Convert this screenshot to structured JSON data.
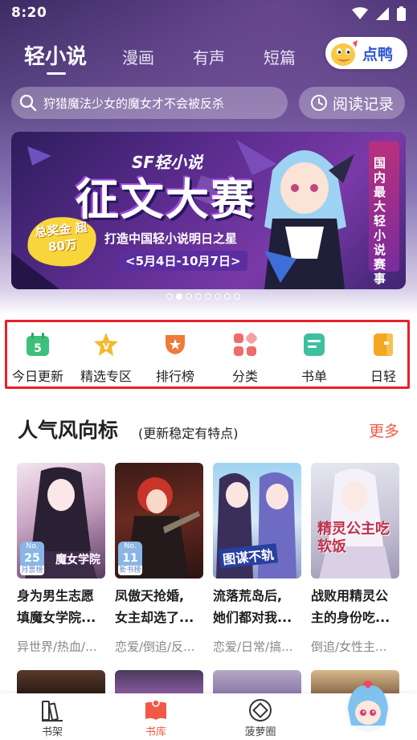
{
  "status_bar": {
    "time": "8:20"
  },
  "top_tabs": [
    {
      "label": "轻小说",
      "active": true
    },
    {
      "label": "漫画",
      "active": false
    },
    {
      "label": "有声",
      "active": false
    },
    {
      "label": "短篇",
      "active": false
    }
  ],
  "duck_button": {
    "label": "点鸭"
  },
  "search": {
    "placeholder": "狩猎魔法少女的魔女才不会被反杀"
  },
  "history_button": {
    "label": "阅读记录"
  },
  "banner": {
    "logo": "SF轻小说",
    "title": "征文大赛",
    "subtitle": "打造中国轻小说明日之星",
    "date": "<5月4日-10月7日>",
    "prize": "总奖金 超80万",
    "side_text": "国内最大轻小说赛事",
    "dot_count": 8,
    "active_dot": 1
  },
  "quick_entries": [
    {
      "label": "今日更新",
      "icon": "calendar-icon",
      "color": "#3ec07a"
    },
    {
      "label": "精选专区",
      "icon": "v-star-icon",
      "color": "#f5b82e"
    },
    {
      "label": "排行榜",
      "icon": "trophy-icon",
      "color": "#f07a3a"
    },
    {
      "label": "分类",
      "icon": "category-icon",
      "color": "#f06b6b"
    },
    {
      "label": "书单",
      "icon": "booklist-icon",
      "color": "#3ec0a0"
    },
    {
      "label": "日轻",
      "icon": "book-icon",
      "color": "#f5a623"
    }
  ],
  "section": {
    "title": "人气风向标",
    "subtitle": "(更新稳定有特点)",
    "more": "更多"
  },
  "books": [
    {
      "title_line1": "身为男生志愿",
      "title_line2": "填魔女学院...",
      "tags": "异世界/热血/...",
      "badge_no": "No.",
      "badge_num": "25",
      "badge_label": "月票榜",
      "cover_text": "魔女学院"
    },
    {
      "title_line1": "凤傲天抢婚,",
      "title_line2": "女主却选了...",
      "tags": "恋爱/倒追/反...",
      "badge_no": "No.",
      "badge_num": "11",
      "badge_label": "新书榜",
      "cover_text": ""
    },
    {
      "title_line1": "流落荒岛后,",
      "title_line2": "她们都对我...",
      "tags": "恋爱/日常/搞...",
      "badge_no": "",
      "badge_num": "",
      "badge_label": "",
      "cover_text": "图谋不轨"
    },
    {
      "title_line1": "战败用精灵公",
      "title_line2": "主的身份吃...",
      "tags": "倒追/女性主...",
      "badge_no": "",
      "badge_num": "",
      "badge_label": "",
      "cover_text": "精灵公主吃软饭"
    }
  ],
  "bottom_nav": [
    {
      "label": "书架",
      "icon": "bookshelf-icon",
      "active": false
    },
    {
      "label": "书库",
      "icon": "library-icon",
      "active": true
    },
    {
      "label": "菠萝圈",
      "icon": "pineapple-icon",
      "active": false
    }
  ],
  "colors": {
    "accent": "#f05a46",
    "highlight_border": "#e8202a",
    "duck_text": "#2f56d4"
  }
}
